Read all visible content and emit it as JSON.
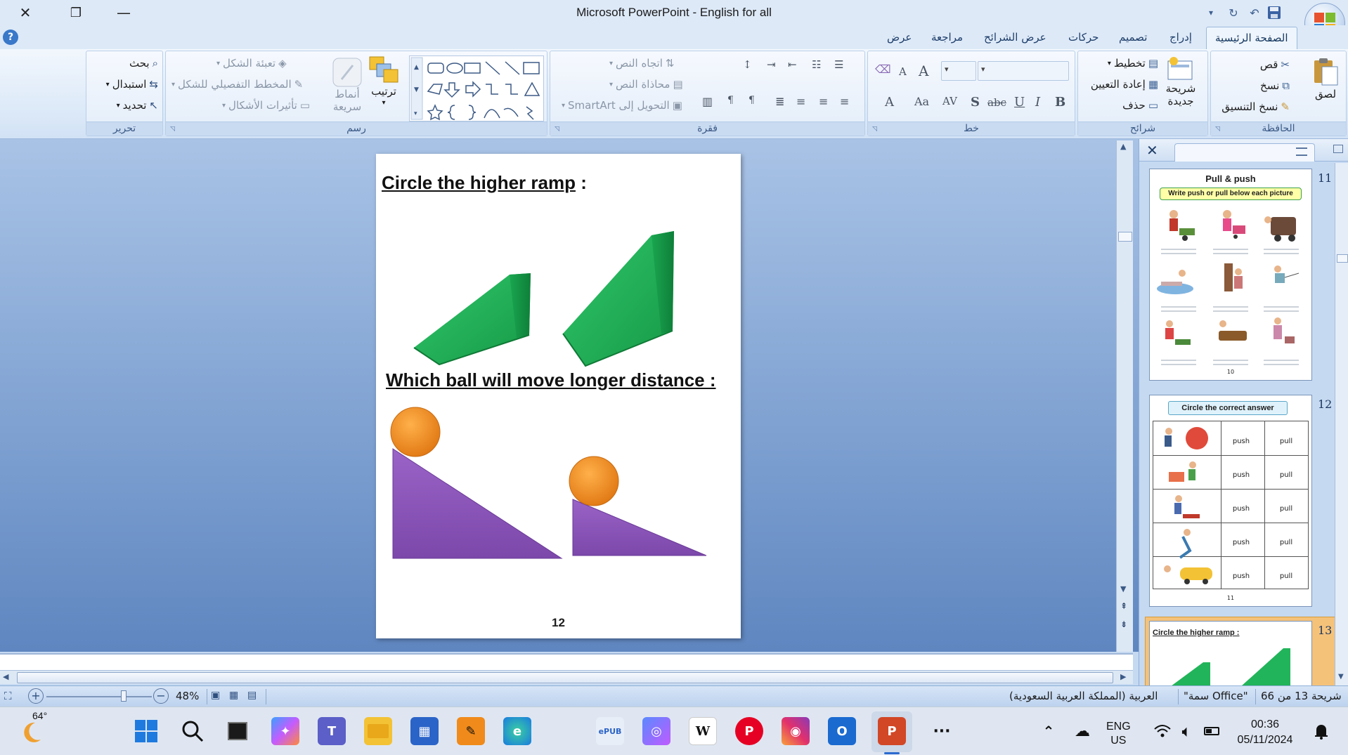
{
  "window": {
    "title": "Microsoft PowerPoint - English for all"
  },
  "ribbon": {
    "tabs": [
      "الصفحة الرئيسية",
      "إدراج",
      "تصميم",
      "حركات",
      "عرض الشرائح",
      "مراجعة",
      "عرض"
    ],
    "active_tab": "الصفحة الرئيسية",
    "clipboard": {
      "label": "الحافظة",
      "paste": "لصق",
      "cut": "قص",
      "copy": "نسخ",
      "format_painter": "نسخ التنسيق"
    },
    "slides": {
      "label": "شرائح",
      "new_slide": "شريحة جديدة",
      "layout": "تخطيط",
      "reset": "إعادة التعيين",
      "delete": "حذف"
    },
    "font": {
      "label": "خط"
    },
    "paragraph": {
      "label": "فقرة",
      "text_direction": "اتجاه النص",
      "align_text": "محاذاة النص",
      "smartart": "التحويل إلى SmartArt"
    },
    "drawing": {
      "label": "رسم",
      "arrange": "ترتيب",
      "quick_styles": "أنماط سريعة",
      "shape_fill": "تعبئة الشكل",
      "shape_outline": "المخطط التفصيلي للشكل",
      "shape_effects": "تأثيرات الأشكال"
    },
    "editing": {
      "label": "تحرير",
      "find": "بحث",
      "replace": "استبدال",
      "select": "تحديد"
    }
  },
  "slide": {
    "heading1_underlined": "Circle the higher ramp",
    "heading1_suffix": " :",
    "heading2": "Which ball will move longer distance :",
    "number": "12"
  },
  "thumbnails": [
    {
      "num": "11",
      "title": "Pull & push",
      "subtitle": "Write push or pull below each picture",
      "page": "10"
    },
    {
      "num": "12",
      "title": "Circle the correct answer",
      "rows": [
        [
          "push",
          "pull"
        ],
        [
          "push",
          "pull"
        ],
        [
          "push",
          "pull"
        ],
        [
          "push",
          "pull"
        ],
        [
          "push",
          "pull"
        ]
      ],
      "page": "11"
    },
    {
      "num": "13",
      "title": "Circle the higher ramp :"
    }
  ],
  "status": {
    "slide_position": "شريحة 13 من 66",
    "theme": "\"سمة Office\"",
    "language": "العربية (المملكة العربية السعودية)",
    "zoom": "48%"
  },
  "taskbar": {
    "weather": "64°",
    "lang_line1": "ENG",
    "lang_line2": "US",
    "time": "00:36",
    "date": "05/11/2024"
  },
  "colors": {
    "ramp": "#1fb45a",
    "ball": "#f28c1e",
    "wedge": "#8a56b5",
    "accent": "#2b579a"
  }
}
